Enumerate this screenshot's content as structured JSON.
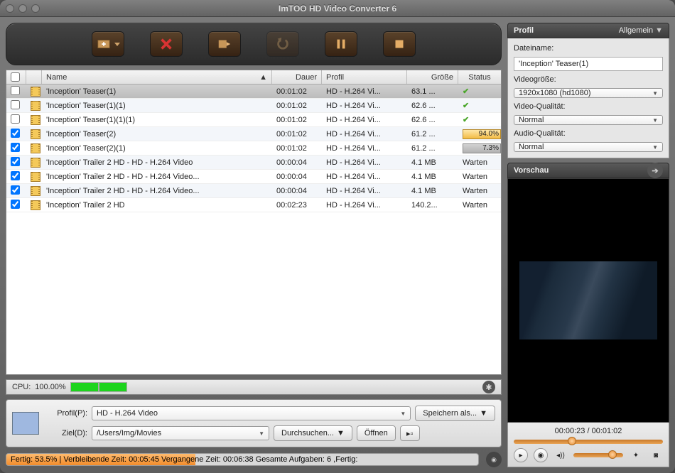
{
  "window": {
    "title": "ImTOO HD Video Converter 6"
  },
  "columns": {
    "name": "Name",
    "duration": "Dauer",
    "profile": "Profil",
    "size": "Größe",
    "status": "Status"
  },
  "rows": [
    {
      "checked": false,
      "selected": true,
      "name": "'Inception' Teaser(1)",
      "dur": "00:01:02",
      "prof": "HD - H.264 Vi...",
      "size": "63.1 ...",
      "status": "done"
    },
    {
      "checked": false,
      "selected": false,
      "name": "   'Inception' Teaser(1)(1)",
      "dur": "00:01:02",
      "prof": "HD - H.264 Vi...",
      "size": "62.6 ...",
      "status": "done"
    },
    {
      "checked": false,
      "selected": false,
      "name": "   'Inception' Teaser(1)(1)(1)",
      "dur": "00:01:02",
      "prof": "HD - H.264 Vi...",
      "size": "62.6 ...",
      "status": "done"
    },
    {
      "checked": true,
      "selected": false,
      "name": "'Inception' Teaser(2)",
      "dur": "00:01:02",
      "prof": "HD - H.264 Vi...",
      "size": "61.2 ...",
      "status": "progress",
      "pct": "94.0%",
      "gray": false
    },
    {
      "checked": true,
      "selected": false,
      "name": "   'Inception' Teaser(2)(1)",
      "dur": "00:01:02",
      "prof": "HD - H.264 Vi...",
      "size": "61.2 ...",
      "status": "progress",
      "pct": "7.3%",
      "gray": true
    },
    {
      "checked": true,
      "selected": false,
      "name": "'Inception' Trailer 2 HD - HD - H.264 Video",
      "dur": "00:00:04",
      "prof": "HD - H.264 Vi...",
      "size": "4.1 MB",
      "status": "wait"
    },
    {
      "checked": true,
      "selected": false,
      "name": "   'Inception' Trailer 2 HD - HD - H.264 Video...",
      "dur": "00:00:04",
      "prof": "HD - H.264 Vi...",
      "size": "4.1 MB",
      "status": "wait"
    },
    {
      "checked": true,
      "selected": false,
      "name": "   'Inception' Trailer 2 HD - HD - H.264 Video...",
      "dur": "00:00:04",
      "prof": "HD - H.264 Vi...",
      "size": "4.1 MB",
      "status": "wait"
    },
    {
      "checked": true,
      "selected": false,
      "name": "'Inception' Trailer 2 HD",
      "dur": "00:02:23",
      "prof": "HD - H.264 Vi...",
      "size": "140.2...",
      "status": "wait"
    }
  ],
  "status_wait": "Warten",
  "cpu": {
    "label": "CPU:",
    "value": "100.00%"
  },
  "bottom": {
    "profile_label": "Profil(P):",
    "profile_value": "HD - H.264 Video",
    "save_as": "Speichern als...",
    "dest_label": "Ziel(D):",
    "dest_value": "/Users/Img/Movies",
    "browse": "Durchsuchen...",
    "open": "Öffnen"
  },
  "status_line": "Fertig: 53.5% | Verbleibende Zeit: 00:05:45 Vergangene Zeit: 00:06:38 Gesamte Aufgaben: 6 ,Fertig:",
  "profile_panel": {
    "title": "Profil",
    "general": "Allgemein",
    "filename_label": "Dateiname:",
    "filename": "'Inception' Teaser(1)",
    "videosize_label": "Videogröße:",
    "videosize": "1920x1080 (hd1080)",
    "vquality_label": "Video-Qualität:",
    "vquality": "Normal",
    "aquality_label": "Audio-Qualität:",
    "aquality": "Normal"
  },
  "preview": {
    "title": "Vorschau",
    "time": "00:00:23 / 00:01:02"
  }
}
